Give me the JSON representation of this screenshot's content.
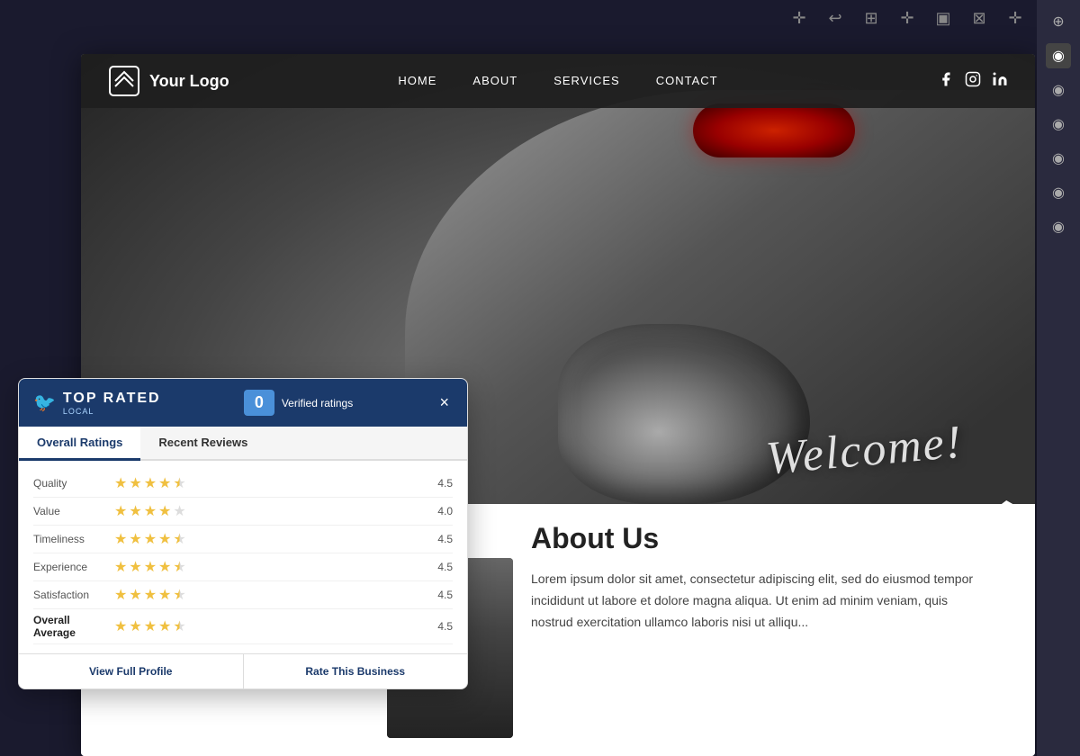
{
  "toolbar": {
    "top_icons": [
      "✛",
      "↩",
      "⊞",
      "✛",
      "▣",
      "⊠",
      "✛"
    ],
    "right_icons": [
      "⊕",
      "◉",
      "◉",
      "◉",
      "◉",
      "◉",
      "◉"
    ]
  },
  "navbar": {
    "logo_text": "Your Logo",
    "links": [
      "HOME",
      "ABOUT",
      "SERVICES",
      "CONTACT"
    ],
    "social": [
      "f",
      "insta",
      "in"
    ]
  },
  "hero": {
    "welcome_text": "Welcome!"
  },
  "about": {
    "title": "About Us",
    "body": "Lorem ipsum dolor sit amet, consectetur adipiscing elit, sed do eiusmod tempor incididunt ut labore et dolore magna aliqua. Ut enim ad minim veniam, quis nostrud exercitation ullamco laboris nisi ut alliqu..."
  },
  "top_rated_widget": {
    "brand": "TOP RATED",
    "sub": "LOCAL",
    "rating_count": "0",
    "verified_text": "Verified ratings",
    "close_btn": "×",
    "tabs": [
      "Overall Ratings",
      "Recent Reviews"
    ],
    "active_tab": "Overall Ratings",
    "ratings": [
      {
        "label": "Quality",
        "score": 4.5,
        "stars": [
          1,
          1,
          1,
          1,
          0.5,
          0
        ]
      },
      {
        "label": "Value",
        "score": 4.0,
        "stars": [
          1,
          1,
          1,
          1,
          0,
          0
        ]
      },
      {
        "label": "Timeliness",
        "score": 4.5,
        "stars": [
          1,
          1,
          1,
          1,
          0.5,
          0
        ]
      },
      {
        "label": "Experience",
        "score": 4.5,
        "stars": [
          1,
          1,
          1,
          1,
          0.5,
          0
        ]
      },
      {
        "label": "Satisfaction",
        "score": 4.5,
        "stars": [
          1,
          1,
          1,
          1,
          0.5,
          0
        ]
      },
      {
        "label": "Overall Average",
        "score": 4.5,
        "stars": [
          1,
          1,
          1,
          1,
          0.5,
          0
        ],
        "bold": true
      }
    ],
    "buttons": [
      "View Full Profile",
      "Rate This Business"
    ]
  }
}
